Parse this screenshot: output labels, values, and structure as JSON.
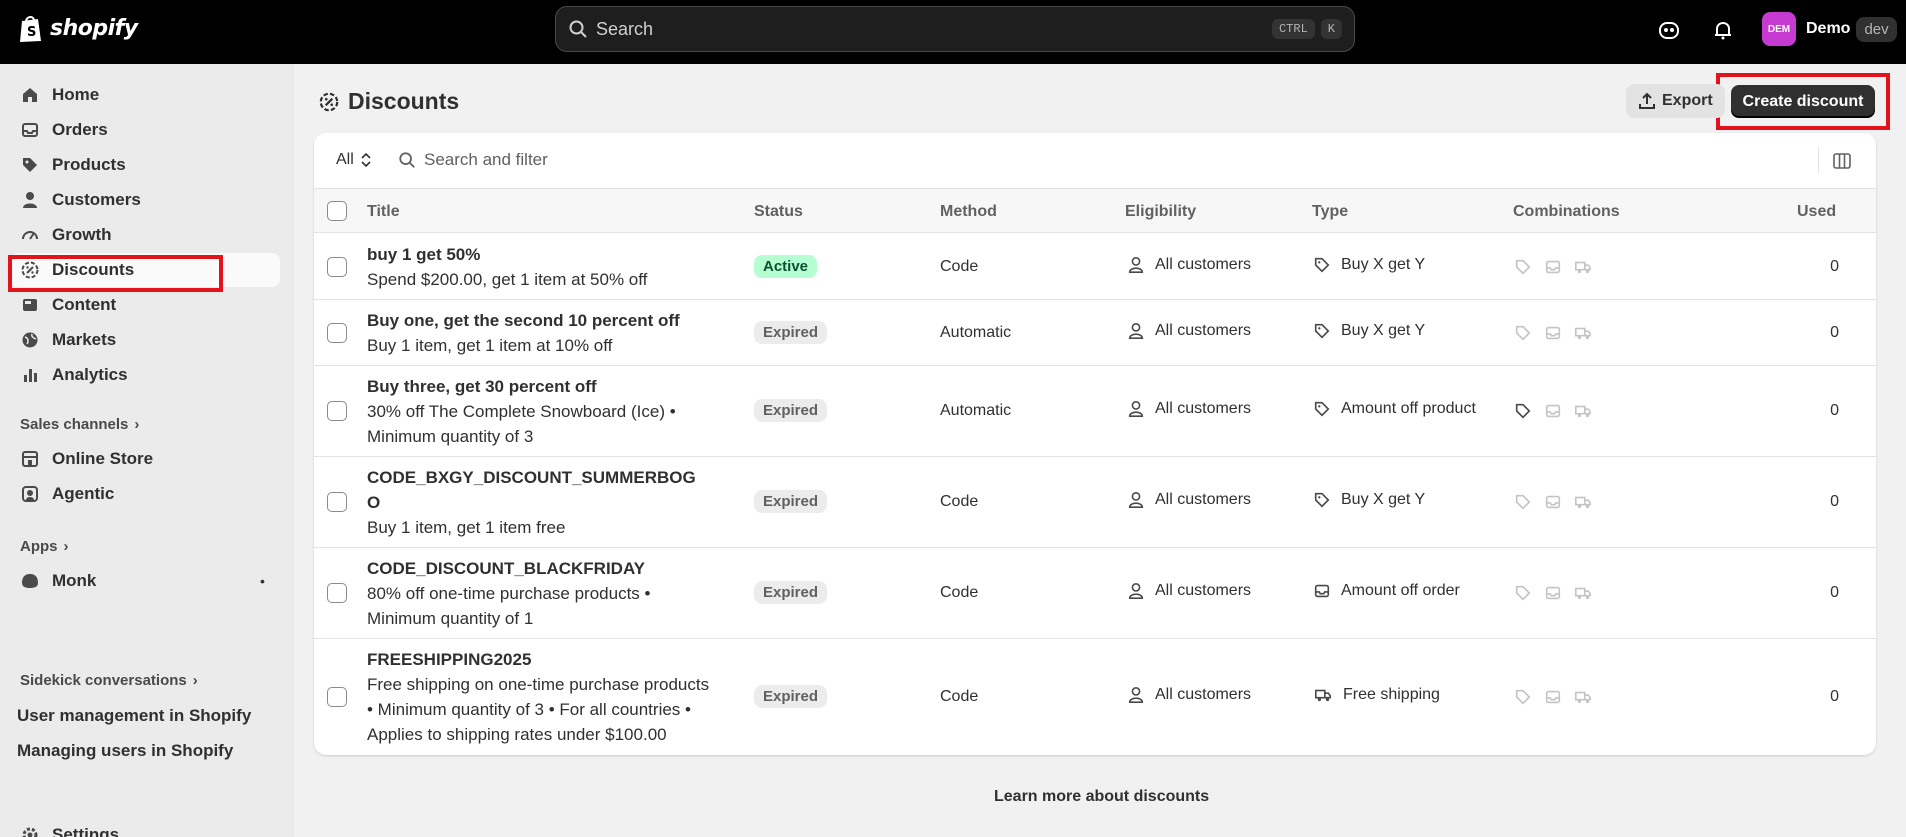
{
  "topbar": {
    "brand": "shopify",
    "search_placeholder": "Search",
    "shortcut_ctrl": "CTRL",
    "shortcut_key": "K",
    "avatar_initials": "DEM",
    "user_name": "Demo",
    "store_badge": "dev"
  },
  "sidebar": {
    "items": [
      {
        "label": "Home",
        "icon": "home-icon"
      },
      {
        "label": "Orders",
        "icon": "inbox-icon"
      },
      {
        "label": "Products",
        "icon": "tag-icon"
      },
      {
        "label": "Customers",
        "icon": "person-icon"
      },
      {
        "label": "Growth",
        "icon": "gauge-icon"
      },
      {
        "label": "Discounts",
        "icon": "discount-icon"
      },
      {
        "label": "Content",
        "icon": "image-icon"
      },
      {
        "label": "Markets",
        "icon": "globe-icon"
      },
      {
        "label": "Analytics",
        "icon": "bar-chart-icon"
      }
    ],
    "sales_channels_label": "Sales channels",
    "channels": [
      {
        "label": "Online Store",
        "icon": "store-icon"
      },
      {
        "label": "Agentic",
        "icon": "agent-icon"
      }
    ],
    "apps_label": "Apps",
    "apps": [
      {
        "label": "Monk",
        "icon": "monk-icon",
        "dot": "•"
      }
    ],
    "sidekick_label": "Sidekick conversations",
    "conversations": [
      "User management in Shopify",
      "Managing users in Shopify"
    ],
    "settings_label": "Settings"
  },
  "page": {
    "title": "Discounts",
    "export_label": "Export",
    "create_label": "Create discount",
    "filter_all": "All",
    "filter_placeholder": "Search and filter",
    "learn_more": "Learn more about discounts"
  },
  "table": {
    "columns": [
      "Title",
      "Status",
      "Method",
      "Eligibility",
      "Type",
      "Combinations",
      "Used"
    ],
    "rows": [
      {
        "title": "buy 1 get 50%",
        "lines": [
          "Spend $200.00, get 1 item at 50% off"
        ],
        "status": "Active",
        "method": "Code",
        "eligibility": "All customers",
        "type": "Buy X get Y",
        "type_icon": "tag-icon",
        "used": "0"
      },
      {
        "title": "Buy one, get the second 10 percent off",
        "lines": [
          "Buy 1 item, get 1 item at 10% off"
        ],
        "status": "Expired",
        "method": "Automatic",
        "eligibility": "All customers",
        "type": "Buy X get Y",
        "type_icon": "tag-icon",
        "used": "0"
      },
      {
        "title": "Buy three, get 30 percent off",
        "lines": [
          "30% off The Complete Snowboard (Ice) •",
          "Minimum quantity of 3"
        ],
        "status": "Expired",
        "method": "Automatic",
        "eligibility": "All customers",
        "type": "Amount off product",
        "type_icon": "tag-icon",
        "used": "0"
      },
      {
        "title": "CODE_BXGY_DISCOUNT_SUMMERBOG",
        "title2": "O",
        "lines": [
          "Buy 1 item, get 1 item free"
        ],
        "status": "Expired",
        "method": "Code",
        "eligibility": "All customers",
        "type": "Buy X get Y",
        "type_icon": "tag-icon",
        "used": "0"
      },
      {
        "title": "CODE_DISCOUNT_BLACKFRIDAY",
        "lines": [
          "80% off one-time purchase products •",
          "Minimum quantity of 1"
        ],
        "status": "Expired",
        "method": "Code",
        "eligibility": "All customers",
        "type": "Amount off order",
        "type_icon": "inbox-icon",
        "used": "0"
      },
      {
        "title": "FREESHIPPING2025",
        "lines": [
          "Free shipping on one-time purchase products",
          "• Minimum quantity of 3 • For all countries •",
          "Applies to shipping rates under $100.00"
        ],
        "status": "Expired",
        "method": "Code",
        "eligibility": "All customers",
        "type": "Free shipping",
        "type_icon": "truck-icon",
        "used": "0"
      }
    ]
  },
  "colors": {
    "highlight": "#e3131b",
    "active_badge": "#b4fed2",
    "avatar": "#c53ad1"
  }
}
